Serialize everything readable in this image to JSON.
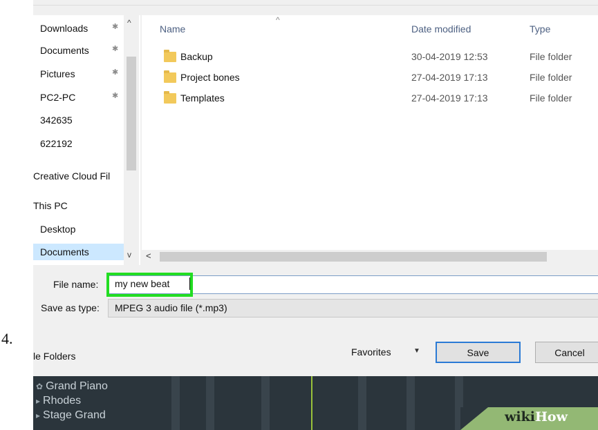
{
  "step_number": "4.",
  "nav": {
    "up_arrow": "^",
    "down_arrow": "v",
    "items": [
      {
        "label": "Downloads",
        "pinned": true
      },
      {
        "label": "Documents",
        "pinned": true
      },
      {
        "label": "Pictures",
        "pinned": true
      },
      {
        "label": "PC2-PC",
        "pinned": true
      },
      {
        "label": "342635"
      },
      {
        "label": "622192"
      },
      {
        "label": "Creative Cloud Fil"
      },
      {
        "label": "This PC"
      },
      {
        "label": "Desktop"
      },
      {
        "label": "Documents",
        "selected": true
      }
    ]
  },
  "file_list": {
    "sort_caret": "^",
    "columns": {
      "name": "Name",
      "date": "Date modified",
      "type": "Type"
    },
    "rows": [
      {
        "name": "Backup",
        "date": "30-04-2019 12:53",
        "type": "File folder"
      },
      {
        "name": "Project bones",
        "date": "27-04-2019 17:13",
        "type": "File folder"
      },
      {
        "name": "Templates",
        "date": "27-04-2019 17:13",
        "type": "File folder"
      }
    ]
  },
  "hscroll_left": "<",
  "pin_glyph": "✱",
  "fields": {
    "file_name_label": "File name:",
    "file_name_value": "my new beat",
    "save_type_label": "Save as type:",
    "save_type_value": "MPEG 3 audio file (*.mp3)"
  },
  "bottom_bar": {
    "hide_folders": "le Folders",
    "favorites": "Favorites",
    "favorites_caret": "▼",
    "save": "Save",
    "cancel": "Cancel"
  },
  "daw": {
    "instruments": [
      "Grand Piano",
      "Rhodes",
      "Stage Grand"
    ]
  },
  "watermark": {
    "part1": "wiki",
    "part2": "How"
  },
  "colors": {
    "highlight": "#22dd22",
    "save_border": "#2a7ad5",
    "selected_nav": "#cce8ff",
    "wikihow_green": "#93b874"
  }
}
